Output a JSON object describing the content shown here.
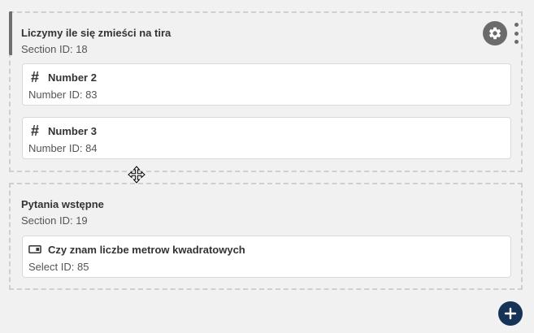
{
  "sections": [
    {
      "title": "Liczymy ile się zmieści na tira",
      "subtitle": "Section  ID: 18",
      "fields": [
        {
          "icon": "hash-icon",
          "title": "Number 2",
          "subtitle": "Number  ID: 83"
        },
        {
          "icon": "hash-icon",
          "title": "Number 3",
          "subtitle": "Number  ID: 84"
        }
      ]
    },
    {
      "title": "Pytania wstępne",
      "subtitle": "Section  ID: 19",
      "fields": [
        {
          "icon": "select-icon",
          "title": "Czy znam liczbe metrow kwadratowych",
          "subtitle": "Select  ID: 85"
        }
      ]
    }
  ],
  "icons": {
    "hash": "#",
    "settings": "gear-icon",
    "more": "kebab-menu-icon",
    "add": "plus-icon",
    "cursor": "move-cursor-icon"
  },
  "colors": {
    "background": "#f1f1f1",
    "gear": "#6b6b6b",
    "add_button": "#143356"
  }
}
